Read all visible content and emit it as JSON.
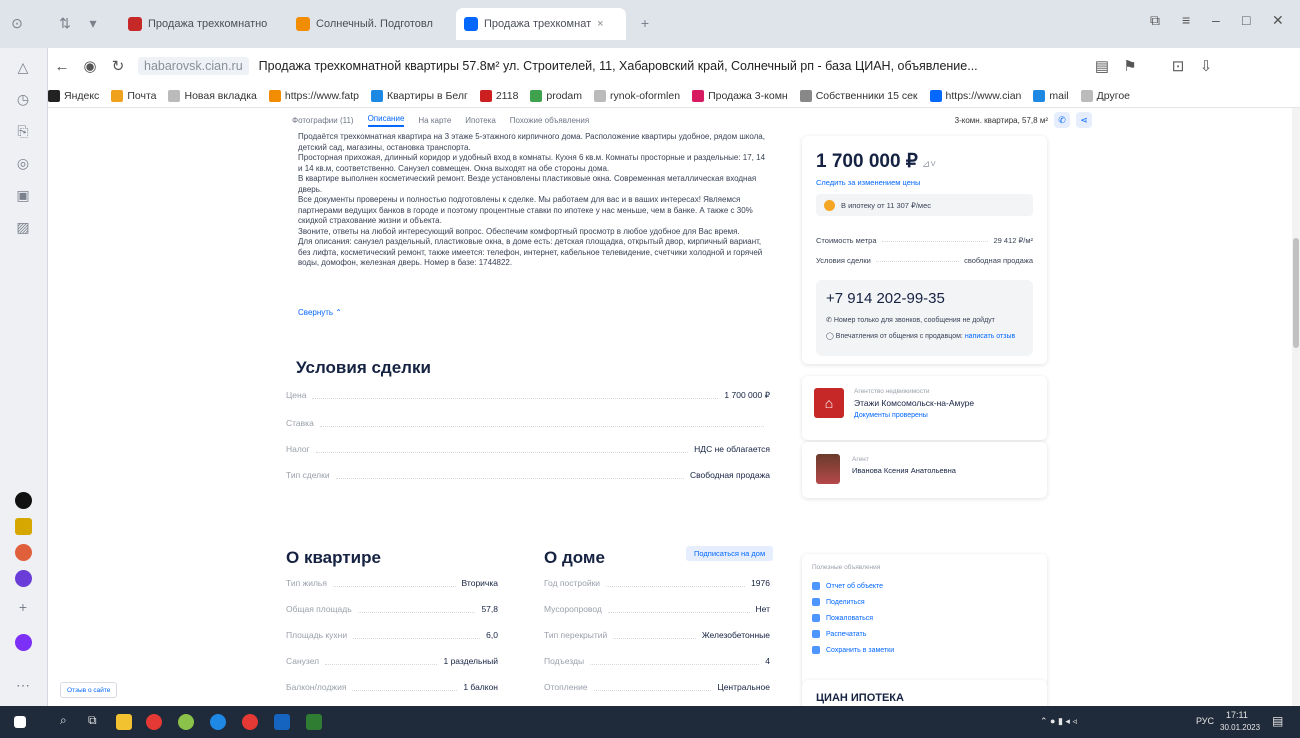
{
  "browser": {
    "tabs": [
      {
        "label": "Продажа трехкомнатно",
        "active": false
      },
      {
        "label": "Солнечный. Подготовл",
        "active": false
      },
      {
        "label": "Продажа трехкомнат",
        "active": true
      }
    ],
    "address": {
      "domain": "habarovsk.cian.ru",
      "title": "Продажа трехкомнатной квартиры 57.8м² ул. Строителей, 11, Хабаровский край, Солнечный рп - база ЦИАН, объявление..."
    },
    "bookmarks": [
      "Яндекс",
      "Почта",
      "Новая вкладка",
      "https://www.fatp",
      "Квартиры в Белг",
      "2118",
      "prodam",
      "rynok-oformlen",
      "Продажа 3-комн",
      "Собственники 15 сек",
      "https://www.cian",
      "mail",
      "Другое"
    ],
    "bookmark_colors": [
      "#222222",
      "#f0a21f",
      "#bbbbbb",
      "#f28c00",
      "#1e88e5",
      "#cc1f1f",
      "#3fa34d",
      "#bbbbbb",
      "#d81b60",
      "#888888",
      "#0468ff",
      "#1e88e5",
      "#bbbbbb"
    ]
  },
  "subnav": {
    "items": [
      "Фотографии (11)",
      "Описание",
      "На карте",
      "Ипотека",
      "Похожие объявления"
    ],
    "active_index": 1,
    "summary": "3-комн. квартира, 57,8 м²"
  },
  "description": {
    "paragraphs": [
      "Продаётся трехкомнатная квартира на 3 этаже 5-этажного кирпичного дома. Расположение квартиры удобное, рядом школа, детский сад, магазины, остановка транспорта.",
      "Просторная прихожая, длинный коридор и удобный вход в комнаты. Кухня 6 кв.м. Комнаты просторные и раздельные: 17, 14 и 14 кв.м, соответственно. Санузел совмещен. Окна выходят на обе стороны дома.",
      "В квартире выполнен косметический ремонт. Везде установлены пластиковые окна. Современная металлическая входная дверь.",
      "Все документы проверены и полностью подготовлены к сделке. Мы работаем для вас и в ваших интересах! Являемся партнерами ведущих банков в городе и поэтому процентные ставки по ипотеке у нас меньше, чем в банке. А также с 30% скидкой страхование жизни и объекта.",
      "Звоните, ответы на любой интересующий вопрос. Обеспечим комфортный просмотр в любое удобное для Вас время.",
      "Для описания: санузел раздельный, пластиковые окна, в доме есть: детская площадка, открытый двор, кирпичный вариант, без лифта, косметический ремонт, также имеется: телефон, интернет, кабельное телевидение, счетчики холодной и горячей воды, домофон, железная дверь. Номер в базе: 1744822."
    ],
    "collapse_link": "Свернуть ⌃"
  },
  "deal": {
    "title": "Условия сделки",
    "rows": [
      {
        "label": "Цена",
        "value": "1 700 000 ₽"
      },
      {
        "label": "Ставка",
        "value": ""
      },
      {
        "label": "Налог",
        "value": "НДС не облагается"
      },
      {
        "label": "Тип сделки",
        "value": "Свободная продажа"
      }
    ]
  },
  "apartment": {
    "title": "О квартире",
    "rows": [
      {
        "label": "Тип жилья",
        "value": "Вторичка"
      },
      {
        "label": "Общая площадь",
        "value": "57,8"
      },
      {
        "label": "Площадь кухни",
        "value": "6,0"
      },
      {
        "label": "Санузел",
        "value": "1 раздельный"
      },
      {
        "label": "Балкон/лоджия",
        "value": "1 балкон"
      }
    ]
  },
  "house": {
    "title": "О доме",
    "check_button": "Подписаться на дом",
    "rows": [
      {
        "label": "Год постройки",
        "value": "1976"
      },
      {
        "label": "Мусоропровод",
        "value": "Нет"
      },
      {
        "label": "Тип перекрытий",
        "value": "Железобетонные"
      },
      {
        "label": "Подъезды",
        "value": "4"
      },
      {
        "label": "Отопление",
        "value": "Центральное"
      }
    ]
  },
  "price_card": {
    "price": "1 700 000 ₽",
    "price_suffix": "⊿˅",
    "follow": "Следить за изменением цены",
    "mortgage": "В ипотеку от 11 307 ₽/мес",
    "rows": [
      {
        "label": "Стоимость метра",
        "value": "29 412 ₽/м²"
      },
      {
        "label": "Условия сделки",
        "value": "свободная продажа"
      }
    ],
    "phone": "+7 914 202-99-35",
    "note1": "Номер только для звонков, сообщения не дойдут",
    "note2": "Впечатления от общения с продавцом:",
    "note2_link": "написать отзыв"
  },
  "agency": {
    "caption": "Агентство недвижимости",
    "name": "Этажи Комсомольск-на-Амуре",
    "verified": "Документы проверены"
  },
  "agent": {
    "caption": "Агент",
    "name": "Иванова Ксения Анатольевна"
  },
  "links_card": {
    "title": "Полезные объявления",
    "items": [
      "Отчет об объекте",
      "Поделиться",
      "Пожаловаться",
      "Распечатать",
      "Сохранить в заметки"
    ]
  },
  "cian_card": {
    "label": "ЦИАН ИПОТЕКА"
  },
  "chat_button": "Отзыв о сайте",
  "taskbar": {
    "lang": "РУС",
    "time": "17:11",
    "date": "30.01.2023"
  }
}
